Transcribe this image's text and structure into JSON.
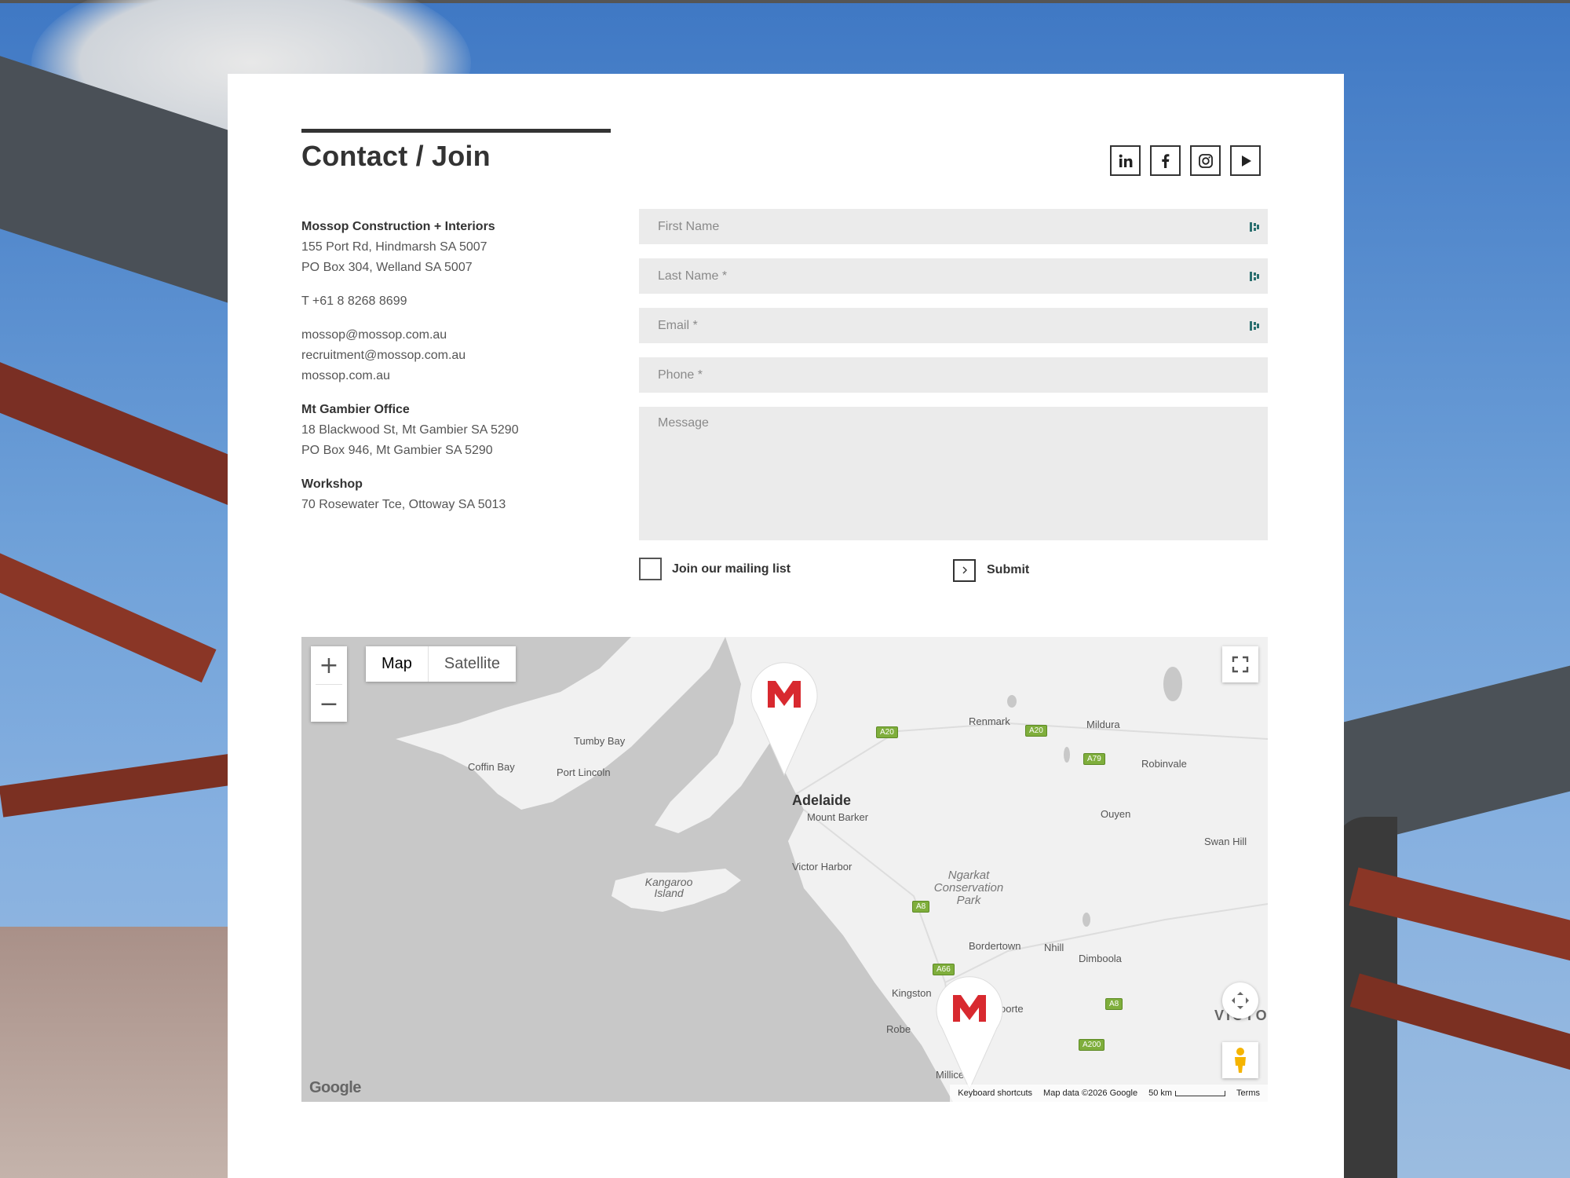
{
  "title": "Contact / Join",
  "social": [
    {
      "name": "linkedin-icon"
    },
    {
      "name": "facebook-icon"
    },
    {
      "name": "instagram-icon"
    },
    {
      "name": "youtube-play-icon"
    }
  ],
  "contact": {
    "company": "Mossop Construction + Interiors",
    "address1": "155 Port Rd, Hindmarsh SA 5007",
    "address2": "PO Box 304, Welland SA 5007",
    "phone": "T +61 8 8268 8699",
    "email1": "mossop@mossop.com.au",
    "email2": "recruitment@mossop.com.au",
    "website": "mossop.com.au",
    "mtg_title": "Mt Gambier Office",
    "mtg_address1": "18 Blackwood St, Mt Gambier SA 5290",
    "mtg_address2": "PO Box 946, Mt Gambier SA 5290",
    "workshop_title": "Workshop",
    "workshop_address": "70 Rosewater Tce, Ottoway SA 5013"
  },
  "form": {
    "first_name_placeholder": "First Name",
    "last_name_placeholder": "Last Name *",
    "email_placeholder": "Email *",
    "phone_placeholder": "Phone *",
    "message_placeholder": "Message",
    "mailing_label": "Join our mailing list",
    "submit_label": "Submit"
  },
  "map": {
    "type_map": "Map",
    "type_satellite": "Satellite",
    "places": {
      "tumby_bay": "Tumby Bay",
      "coffin_bay": "Coffin Bay",
      "port_lincoln": "Port Lincoln",
      "adelaide": "Adelaide",
      "mount_barker": "Mount Barker",
      "victor_harbor": "Victor Harbor",
      "kangaroo_island": "Kangaroo Island",
      "renmark": "Renmark",
      "mildura": "Mildura",
      "robinvale": "Robinvale",
      "ouyen": "Ouyen",
      "swan_hill": "Swan Hill",
      "ngarkat": "Ngarkat Conservation Park",
      "bordertown": "Bordertown",
      "nhill": "Nhill",
      "dimboola": "Dimboola",
      "kingston": "Kingston",
      "naracoorte": "oorte",
      "robe": "Robe",
      "millicent": "Millicent",
      "victoria": "VICTOI"
    },
    "roads": {
      "a20a": "A20",
      "a20b": "A20",
      "a79": "A79",
      "a8a": "A8",
      "a66": "A66",
      "a8b": "A8",
      "a200": "A200"
    },
    "google": "Google",
    "shortcuts": "Keyboard shortcuts",
    "map_data": "Map data ©2026 Google",
    "scale": "50 km",
    "terms": "Terms"
  },
  "colors": {
    "brand_red": "#d8292f",
    "field_bg": "#ebebeb",
    "text_dark": "#333333"
  }
}
